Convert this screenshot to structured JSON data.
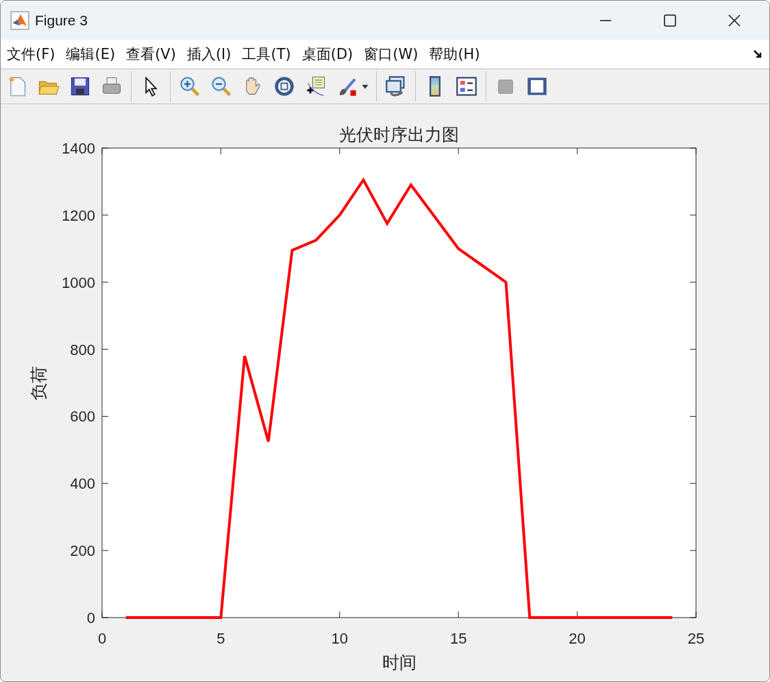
{
  "window": {
    "title": "Figure 3"
  },
  "menu": [
    "文件(F)",
    "编辑(E)",
    "查看(V)",
    "插入(I)",
    "工具(T)",
    "桌面(D)",
    "窗口(W)",
    "帮助(H)"
  ],
  "chart_data": {
    "type": "line",
    "title": "光伏时序出力图",
    "xlabel": "时间",
    "ylabel": "负荷",
    "x": [
      1,
      2,
      3,
      4,
      5,
      6,
      7,
      8,
      9,
      10,
      11,
      12,
      13,
      14,
      15,
      16,
      17,
      18,
      19,
      20,
      21,
      22,
      23,
      24
    ],
    "series": [
      {
        "color": "#ff0000",
        "values": [
          0,
          0,
          0,
          0,
          0,
          780,
          525,
          1095,
          1125,
          1200,
          1305,
          1175,
          1290,
          1195,
          1100,
          1050,
          1000,
          0,
          0,
          0,
          0,
          0,
          0,
          0
        ]
      }
    ],
    "xlim": [
      0,
      25
    ],
    "ylim": [
      0,
      1400
    ],
    "xticks": [
      0,
      5,
      10,
      15,
      20,
      25
    ],
    "yticks": [
      0,
      200,
      400,
      600,
      800,
      1000,
      1200,
      1400
    ]
  }
}
